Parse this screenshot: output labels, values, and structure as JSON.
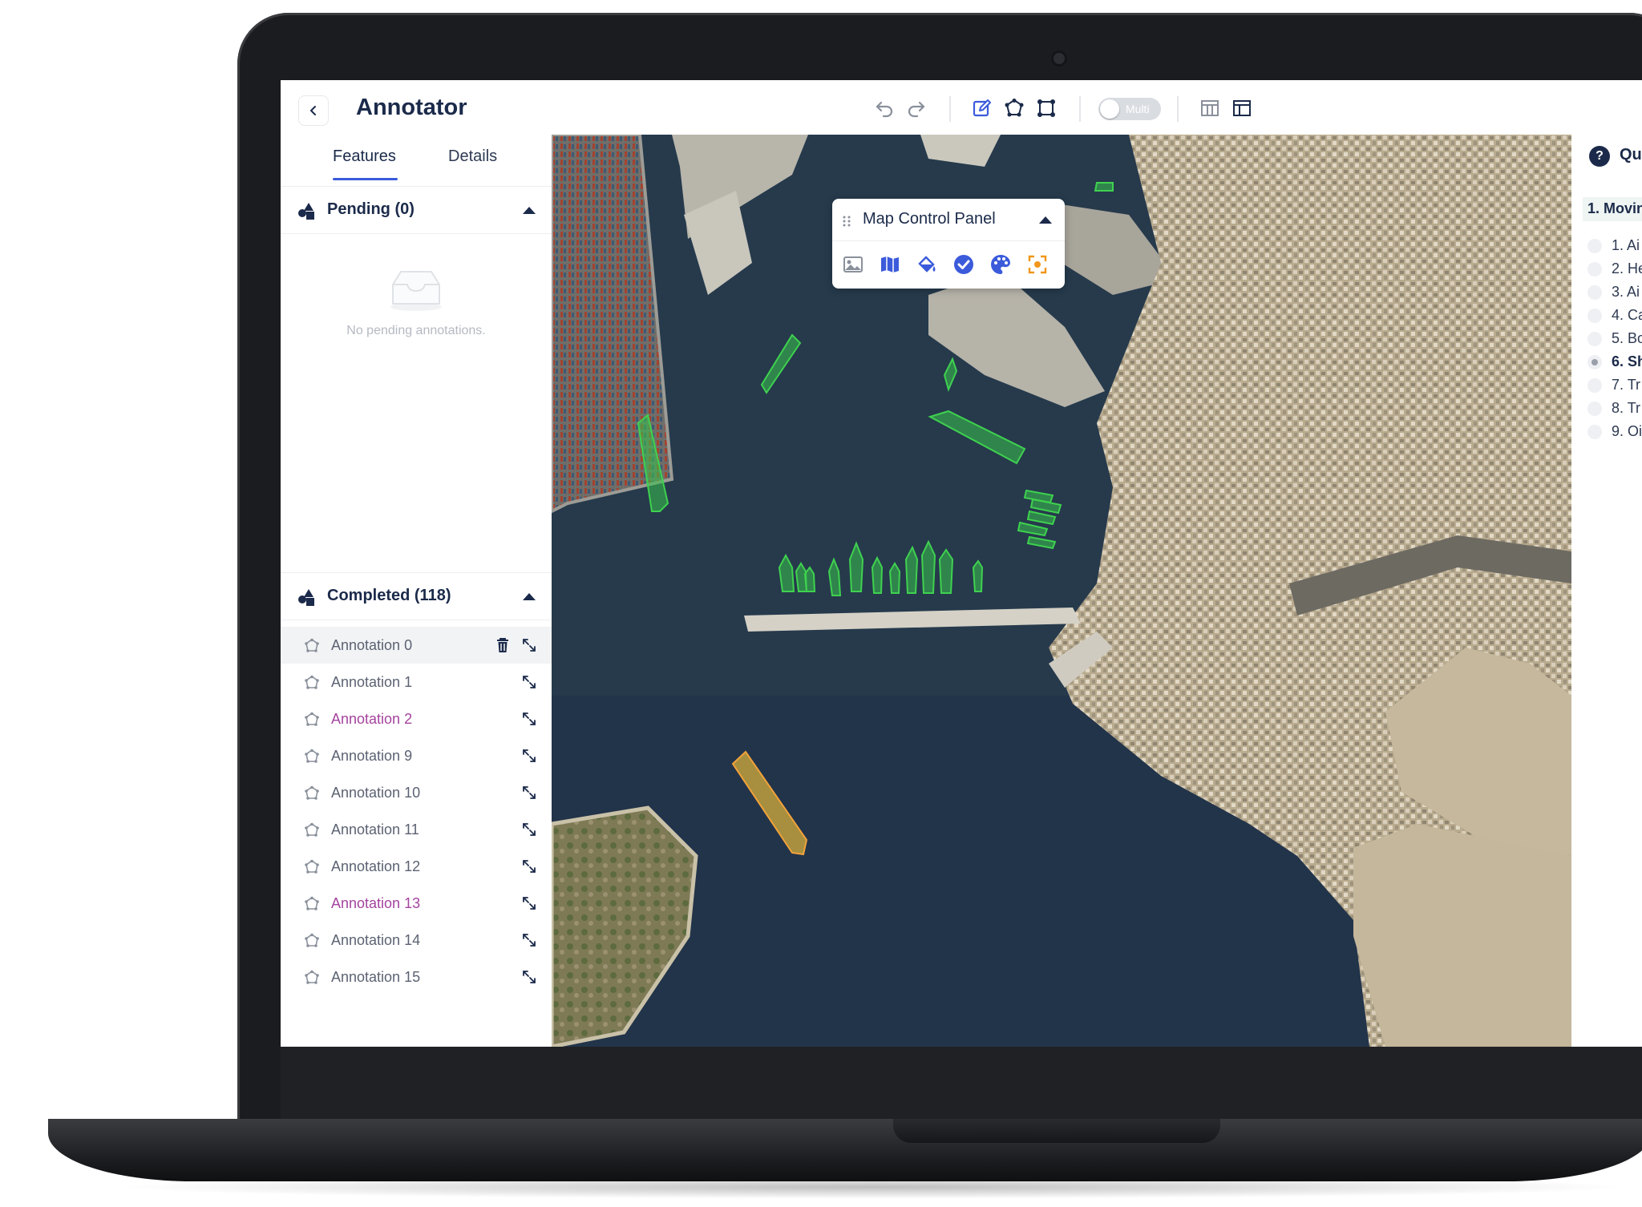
{
  "header": {
    "title": "Annotator",
    "toggle_label": "Multi"
  },
  "left_panel": {
    "tabs": [
      {
        "label": "Features",
        "active": true
      },
      {
        "label": "Details",
        "active": false
      }
    ],
    "pending": {
      "title": "Pending (0)",
      "empty_text": "No pending annotations."
    },
    "completed": {
      "title": "Completed (118)",
      "items": [
        {
          "label": "Annotation 0",
          "selected": true,
          "color": "gray"
        },
        {
          "label": "Annotation 1",
          "selected": false,
          "color": "gray"
        },
        {
          "label": "Annotation 2",
          "selected": false,
          "color": "pink"
        },
        {
          "label": "Annotation 9",
          "selected": false,
          "color": "gray"
        },
        {
          "label": "Annotation 10",
          "selected": false,
          "color": "gray"
        },
        {
          "label": "Annotation 11",
          "selected": false,
          "color": "gray"
        },
        {
          "label": "Annotation 12",
          "selected": false,
          "color": "gray"
        },
        {
          "label": "Annotation 13",
          "selected": false,
          "color": "pink"
        },
        {
          "label": "Annotation 14",
          "selected": false,
          "color": "gray"
        },
        {
          "label": "Annotation 15",
          "selected": false,
          "color": "gray"
        }
      ]
    }
  },
  "map_control_panel": {
    "title": "Map Control Panel",
    "tools": [
      "image-icon",
      "map-icon",
      "paint-bucket-icon",
      "check-circle-icon",
      "palette-icon",
      "focus-icon"
    ]
  },
  "right_panel": {
    "title": "Qu",
    "category_header": "1. Movin",
    "items": [
      {
        "label": "1. Ai",
        "active": false
      },
      {
        "label": "2. He",
        "active": false
      },
      {
        "label": "3. Ai",
        "active": false
      },
      {
        "label": "4. Ca",
        "active": false
      },
      {
        "label": "5. Bo",
        "active": false
      },
      {
        "label": "6. Sh",
        "active": true
      },
      {
        "label": "7. Tr",
        "active": false
      },
      {
        "label": "8. Tr",
        "active": false
      },
      {
        "label": "9. Oi",
        "active": false
      }
    ]
  },
  "colors": {
    "accent": "#3b5bdb",
    "completed_annotation": "#37c24a",
    "selected_annotation": "#e0b63a",
    "title_text": "#1b2a4a",
    "pink_label": "#a4449e"
  }
}
